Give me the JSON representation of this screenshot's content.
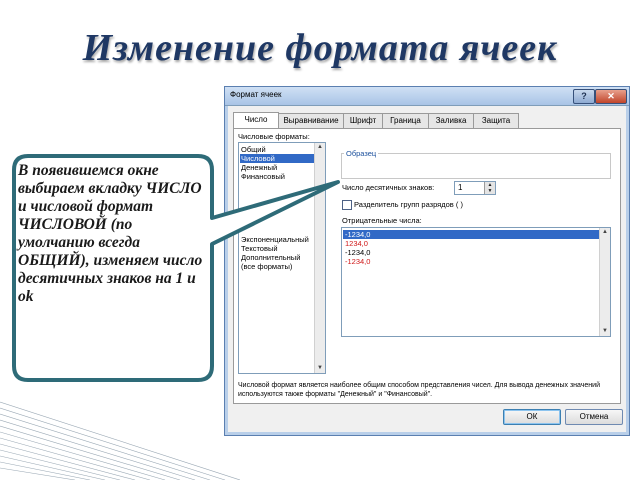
{
  "slide": {
    "title": "Изменение формата ячеек",
    "callout": "В появившемся окне выбираем вкладку ЧИСЛО и числовой формат ЧИСЛОВОЙ (по умолчанию всегда ОБЩИЙ), изменяем число десятичных знаков на 1 и ok"
  },
  "dialog": {
    "title": "Формат ячеек",
    "tabs": [
      {
        "label": "Число"
      },
      {
        "label": "Выравнивание"
      },
      {
        "label": "Шрифт"
      },
      {
        "label": "Граница"
      },
      {
        "label": "Заливка"
      },
      {
        "label": "Защита"
      }
    ],
    "number_formats_label": "Числовые форматы:",
    "formats": [
      "Общий",
      "Числовой",
      "Денежный",
      "Финансовый",
      "Экспоненциальный",
      "Текстовый",
      "Дополнительный",
      "(все форматы)"
    ],
    "selected_format": "Числовой",
    "sample_label": "Образец",
    "decimals_label": "Число десятичных знаков:",
    "decimals_value": "1",
    "separator_label": "Разделитель групп разрядов ( )",
    "negative_label": "Отрицательные числа:",
    "negatives": [
      "-1234,0",
      "1234,0",
      "-1234,0",
      "-1234,0"
    ],
    "description": "Числовой формат является наиболее общим способом представления чисел. Для вывода денежных значений используются также форматы \"Денежный\" и \"Финансовый\".",
    "ok_label": "ОК",
    "cancel_label": "Отмена"
  },
  "colors": {
    "title": "#1f3864",
    "callout_border": "#2e6b78",
    "selection": "#3169c6",
    "negative_red": "#d01818"
  }
}
